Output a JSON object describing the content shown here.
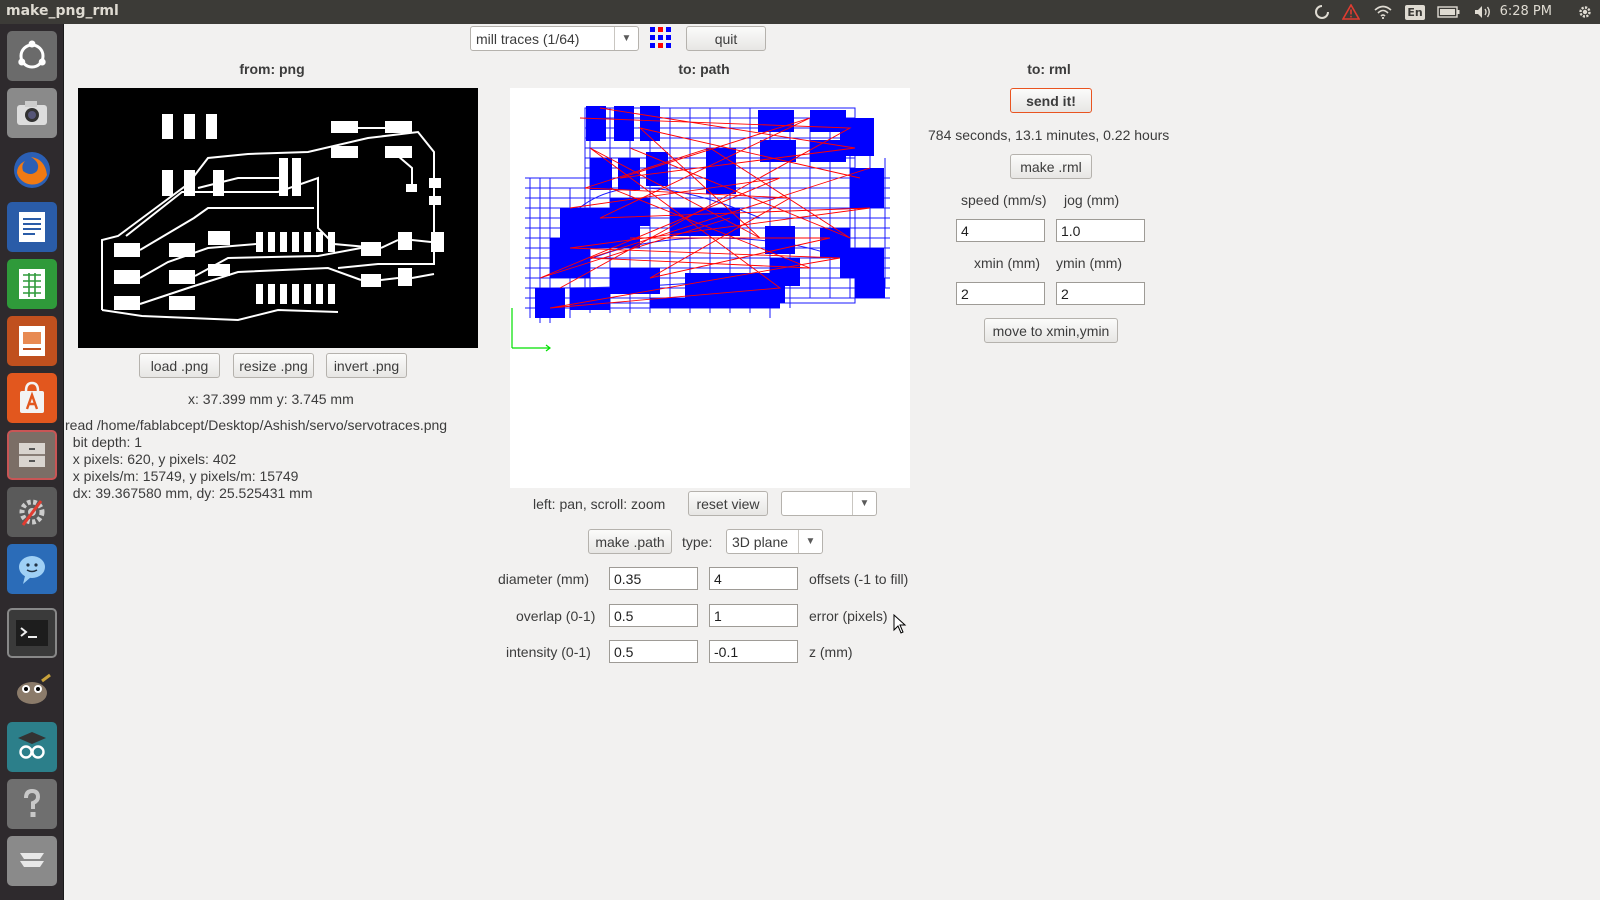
{
  "window": {
    "title": "make_png_rml"
  },
  "system": {
    "keyboard_layout": "En",
    "clock": "6:28 PM"
  },
  "toolbar": {
    "mode_select": "mill traces (1/64)",
    "quit_label": "quit"
  },
  "from_panel": {
    "header": "from: png",
    "load_label": "load .png",
    "resize_label": "resize .png",
    "invert_label": "invert .png",
    "coords": "x: 37.399 mm  y: 3.745 mm",
    "info_lines": [
      "read /home/fablabcept/Desktop/Ashish/servo/servotraces.png",
      "  bit depth: 1",
      "  x pixels: 620, y pixels: 402",
      "  x pixels/m: 15749, y pixels/m: 15749",
      "  dx: 39.367580 mm, dy: 25.525431 mm"
    ]
  },
  "path_panel": {
    "header": "to: path",
    "hint": "left: pan, scroll: zoom",
    "reset_view_label": "reset view",
    "view_select": "",
    "make_path_label": "make .path",
    "type_label": "type:",
    "type_select": "3D plane",
    "diameter_label": "diameter (mm)",
    "diameter_value": "0.35",
    "offsets_value": "4",
    "offsets_label": "offsets (-1 to fill)",
    "overlap_label": "overlap (0-1)",
    "overlap_value": "0.5",
    "error_value": "1",
    "error_label": "error (pixels)",
    "intensity_label": "intensity (0-1)",
    "intensity_value": "0.5",
    "z_value": "-0.1",
    "z_label": "z (mm)"
  },
  "rml_panel": {
    "header": "to: rml",
    "send_label": "send it!",
    "time_estimate": "784 seconds, 13.1 minutes, 0.22 hours",
    "make_rml_label": "make .rml",
    "speed_label": "speed (mm/s)",
    "jog_label": "jog (mm)",
    "speed_value": "4",
    "jog_value": "1.0",
    "xmin_label": "xmin (mm)",
    "ymin_label": "ymin (mm)",
    "xmin_value": "2",
    "ymin_value": "2",
    "move_label": "move to xmin,ymin"
  },
  "colors": {
    "accent": "#e95420",
    "path_blue": "#0000ff",
    "path_red": "#ff0000",
    "topbar": "#3c3b37"
  }
}
